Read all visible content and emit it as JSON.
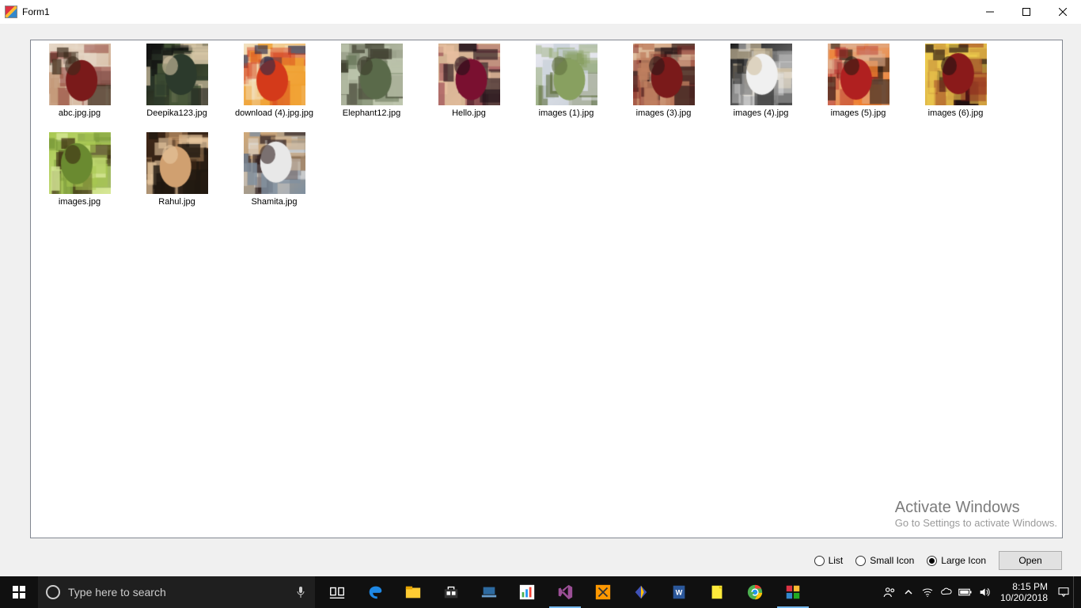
{
  "window": {
    "title": "Form1"
  },
  "viewOptions": {
    "list": "List",
    "smallIcon": "Small Icon",
    "largeIcon": "Large Icon",
    "selected": "largeIcon",
    "openButton": "Open"
  },
  "watermark": {
    "line1": "Activate Windows",
    "line2": "Go to Settings to activate Windows."
  },
  "search": {
    "placeholder": "Type here to search"
  },
  "clock": {
    "time": "8:15 PM",
    "date": "10/20/2018"
  },
  "items": [
    {
      "label": "abc.jpg.jpg",
      "palette": [
        "#7a1a1a",
        "#e7d9c9",
        "#3a2a1a",
        "#c49a7a"
      ]
    },
    {
      "label": "Deepika123.jpg",
      "palette": [
        "#2c3a2c",
        "#111111",
        "#d7c7a7",
        "#4a5a3a"
      ]
    },
    {
      "label": "download (4).jpg.jpg",
      "palette": [
        "#d43a1a",
        "#f2e2c2",
        "#2a2a4a",
        "#f0a030"
      ]
    },
    {
      "label": "Elephant12.jpg",
      "palette": [
        "#5a6a4a",
        "#9aa08a",
        "#3a3a2a",
        "#c0c8b0"
      ]
    },
    {
      "label": "Hello.jpg",
      "palette": [
        "#7a1030",
        "#d0b090",
        "#201018",
        "#e8c0a0"
      ]
    },
    {
      "label": "images (1).jpg",
      "palette": [
        "#88a060",
        "#e8e8f0",
        "#607040",
        "#c8d0d8"
      ]
    },
    {
      "label": "images (3).jpg",
      "palette": [
        "#7a1a1a",
        "#e0c0a0",
        "#2a1818",
        "#c08060"
      ]
    },
    {
      "label": "images (4).jpg",
      "palette": [
        "#f0f0f0",
        "#202020",
        "#d0c0a0",
        "#888888"
      ]
    },
    {
      "label": "images (5).jpg",
      "palette": [
        "#b02020",
        "#e0b090",
        "#2a1a10",
        "#f08030"
      ]
    },
    {
      "label": "images (6).jpg",
      "palette": [
        "#8a1a1a",
        "#f0d050",
        "#201010",
        "#d0a040"
      ]
    },
    {
      "label": "images.jpg",
      "palette": [
        "#6a8a30",
        "#a8c850",
        "#3a2a10",
        "#d8e898"
      ]
    },
    {
      "label": "Rahul.jpg",
      "palette": [
        "#d0a070",
        "#402818",
        "#e8c8a0",
        "#201810"
      ]
    },
    {
      "label": "Shamita.jpg",
      "palette": [
        "#e8e8e8",
        "#d0a878",
        "#302020",
        "#8090a0"
      ]
    }
  ]
}
